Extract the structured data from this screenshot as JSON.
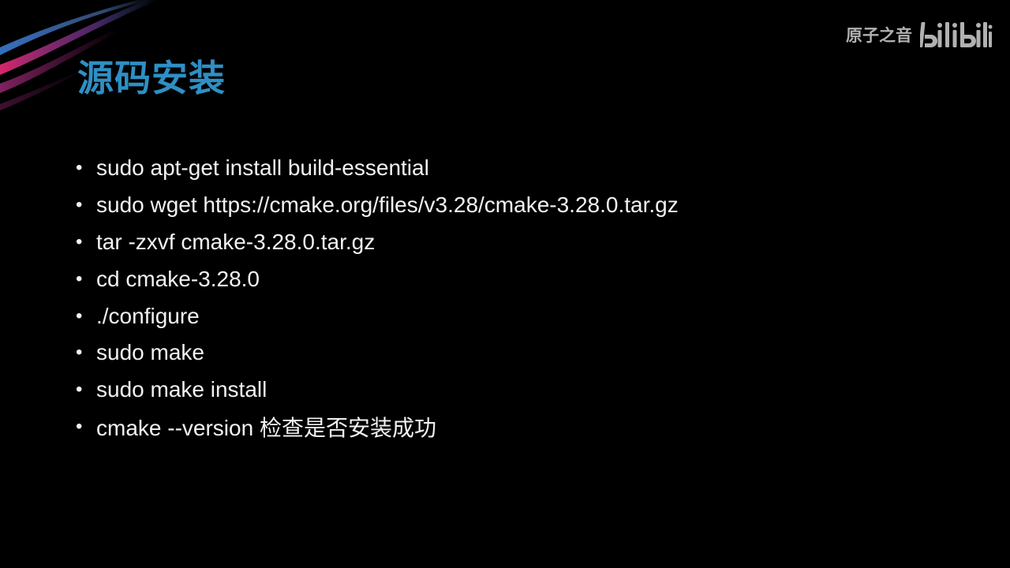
{
  "slide": {
    "title": "源码安装",
    "bullet_symbol": "•",
    "bullets": [
      "sudo apt-get install build-essential",
      "sudo wget https://cmake.org/files/v3.28/cmake-3.28.0.tar.gz",
      "tar -zxvf cmake-3.28.0.tar.gz",
      "cd cmake-3.28.0",
      "./configure",
      "sudo make",
      "sudo make install",
      "cmake --version 检查是否安装成功"
    ]
  },
  "watermark": {
    "channel_name": "原子之音",
    "logo_text": "bilibili",
    "logo_icon": "bilibili-logo-icon"
  },
  "colors": {
    "background": "#000000",
    "title": "#2f8fc4",
    "body_text": "#f2f2f2",
    "swoosh_pink": "#d8246b",
    "swoosh_blue": "#3a7bd5",
    "swoosh_purple": "#7b3fa8"
  }
}
